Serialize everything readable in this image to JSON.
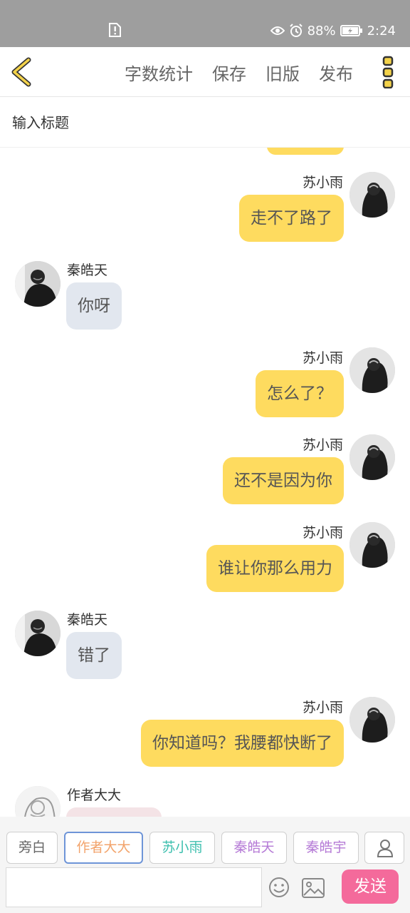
{
  "status_bar": {
    "battery_percent": "88%",
    "time": "2:24",
    "icons": [
      "alert-file-icon",
      "eye-icon",
      "alarm-icon",
      "battery-charging-icon"
    ]
  },
  "toolbar": {
    "back_icon": "chevron-left-icon",
    "actions": [
      "字数统计",
      "保存",
      "旧版",
      "发布"
    ],
    "more_icon": "vertical-dots-icon"
  },
  "title_input": {
    "placeholder": "输入标题",
    "value": ""
  },
  "messages": [
    {
      "side": "right",
      "name": "苏小雨",
      "text": "走不了路了"
    },
    {
      "side": "left",
      "name": "秦皓天",
      "text": "你呀"
    },
    {
      "side": "right",
      "name": "苏小雨",
      "text": "怎么了？"
    },
    {
      "side": "right",
      "name": "苏小雨",
      "text": "还不是因为你"
    },
    {
      "side": "right",
      "name": "苏小雨",
      "text": "谁让你那么用力"
    },
    {
      "side": "left",
      "name": "秦皓天",
      "text": "错了"
    },
    {
      "side": "right",
      "name": "苏小雨",
      "text": "你知道吗？我腰都快断了"
    },
    {
      "side": "left",
      "name": "作者大大",
      "text": ""
    }
  ],
  "roles": [
    {
      "label": "旁白",
      "color": "#666666",
      "selected": false
    },
    {
      "label": "作者大大",
      "color": "#f2a36b",
      "selected": true
    },
    {
      "label": "苏小雨",
      "color": "#3cbfae",
      "selected": false
    },
    {
      "label": "秦皓天",
      "color": "#b57ad6",
      "selected": false
    },
    {
      "label": "秦皓宇",
      "color": "#b57ad6",
      "selected": false
    }
  ],
  "role_user_icon": "person-icon",
  "input_bar": {
    "placeholder": "",
    "emoji_icon": "smiley-icon",
    "image_icon": "image-icon",
    "send_label": "发送"
  },
  "colors": {
    "status_bar_bg": "#9e9e9e",
    "right_bubble": "#fedb5f",
    "left_bubble": "#e2e7ef",
    "author_bubble": "#f4e3e6",
    "send_button": "#f46a9b",
    "selected_role_border": "#6e95d8",
    "accent_yellow": "#f3d24a"
  }
}
